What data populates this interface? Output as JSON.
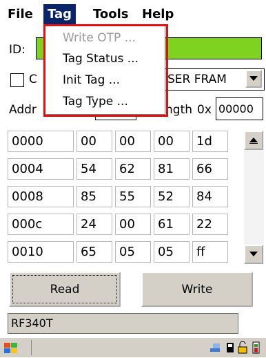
{
  "menubar": {
    "file": "File",
    "tag": "Tag",
    "tools": "Tools",
    "help": "Help"
  },
  "tag_menu": {
    "items": [
      "Write OTP ...",
      "Tag Status ...",
      "Init Tag ...",
      "Tag Type ..."
    ],
    "disabled": [
      true,
      false,
      false,
      false
    ]
  },
  "form": {
    "id_label": "ID:",
    "id_value": "",
    "checkbox_label": "C",
    "tag_type_value": "SER FRAM",
    "addr_label": "Addr",
    "length_label": "ngth",
    "length_prefix": "0x",
    "length_value": "00000"
  },
  "grid": {
    "rows": [
      [
        "0000",
        "00",
        "00",
        "00",
        "1d"
      ],
      [
        "0004",
        "54",
        "62",
        "81",
        "66"
      ],
      [
        "0008",
        "85",
        "55",
        "52",
        "84"
      ],
      [
        "000c",
        "24",
        "00",
        "61",
        "22"
      ],
      [
        "0010",
        "65",
        "05",
        "05",
        "ff"
      ]
    ]
  },
  "buttons": {
    "read": "Read",
    "write": "Write"
  },
  "status": {
    "text": "RF340T"
  },
  "colors": {
    "id_field_bg": "#7ed321",
    "menu_highlight": "#0a246a",
    "annotation_border": "#e01010"
  }
}
